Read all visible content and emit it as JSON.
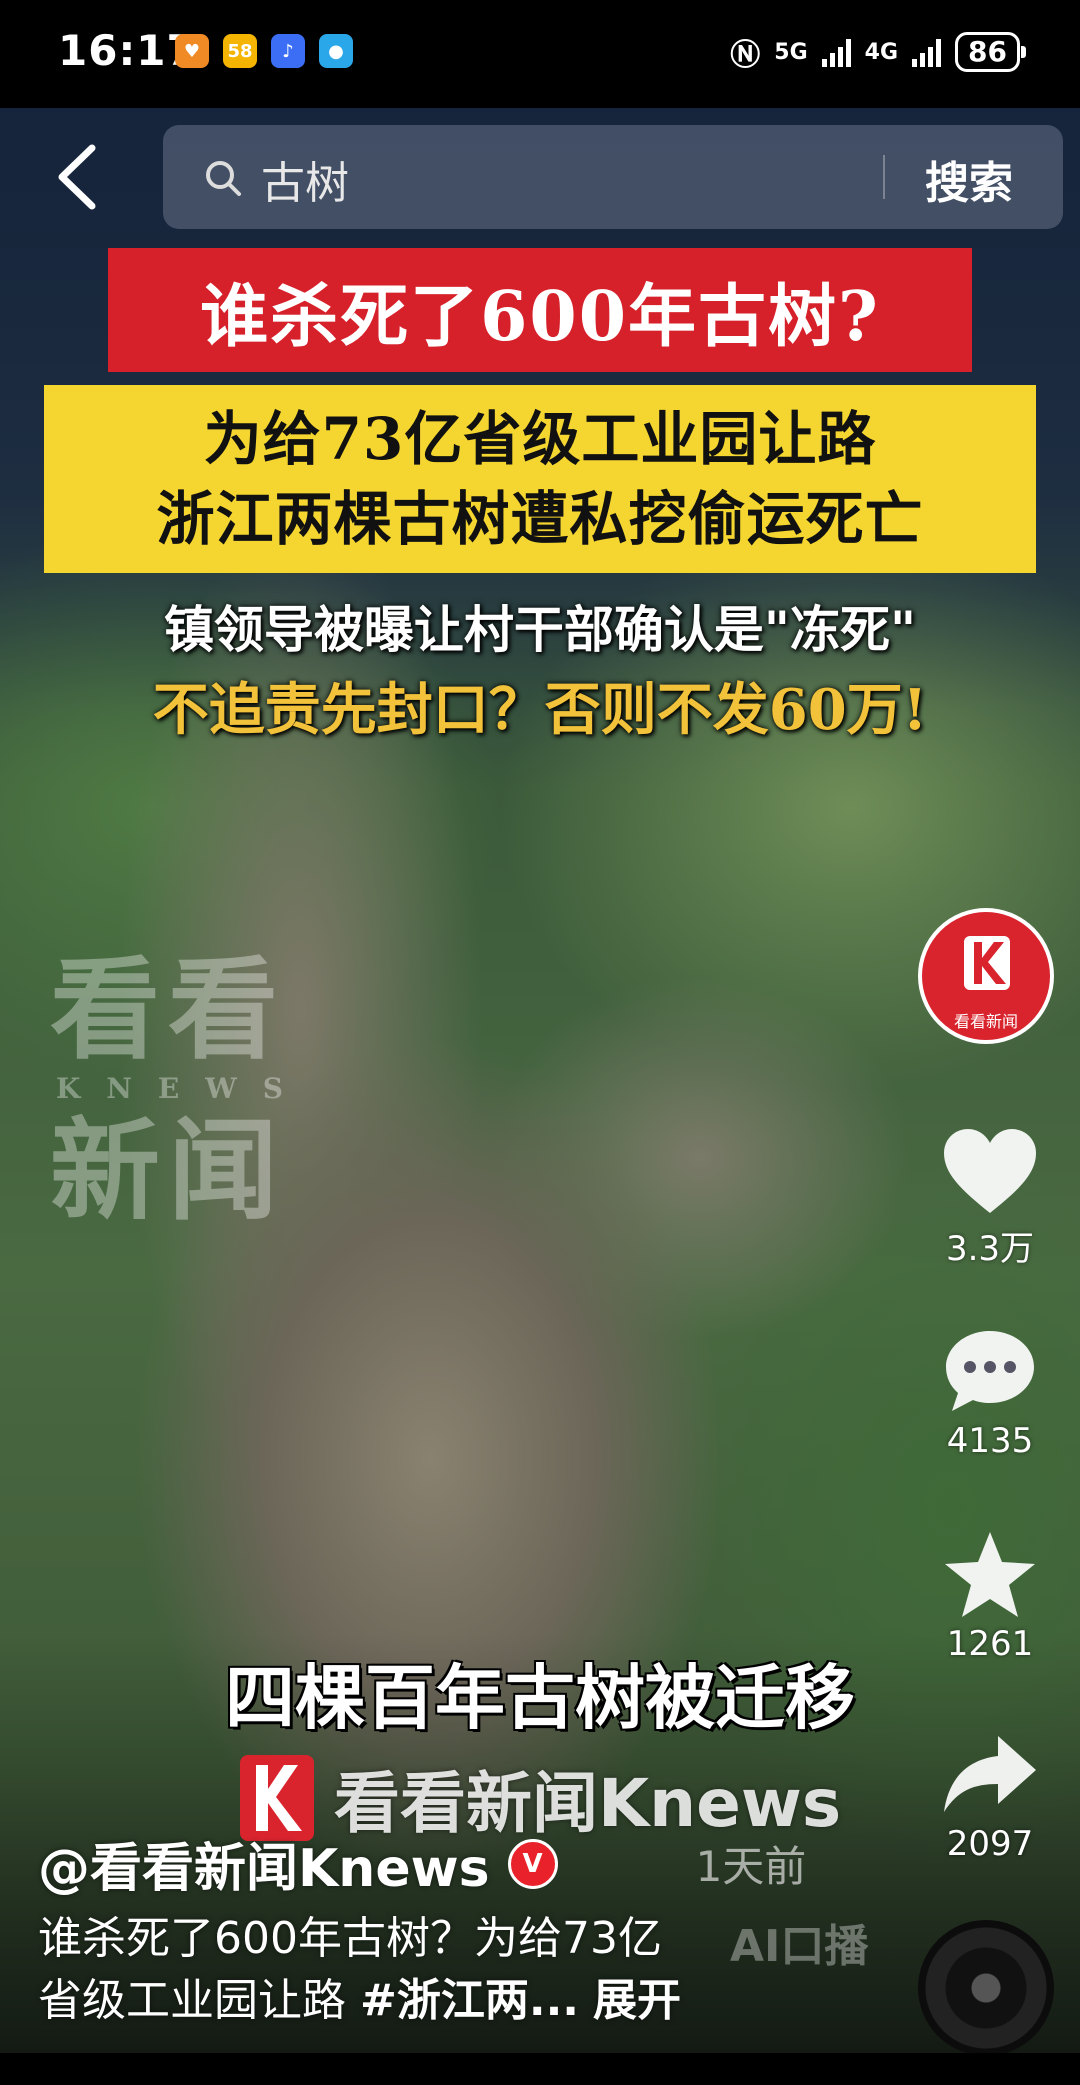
{
  "status_bar": {
    "time": "16:17",
    "apps": [
      {
        "icon": "app-orange-icon",
        "label": "",
        "color": "#f08a24"
      },
      {
        "icon": "app-58-icon",
        "label": "58",
        "color": "#f4b400"
      },
      {
        "icon": "music-icon",
        "label": "♪",
        "color": "#3b6ef5"
      },
      {
        "icon": "app-blue-icon",
        "label": "",
        "color": "#2aa7e8"
      }
    ],
    "network_1": "5G",
    "network_2": "4G",
    "battery": "86"
  },
  "search": {
    "query": "古树",
    "button_label": "搜索"
  },
  "video": {
    "headline": "谁杀死了600年古树?",
    "subhead_line1": "为给73亿省级工业园让路",
    "subhead_line2": "浙江两棵古树遭私挖偷运死亡",
    "line3": "镇领导被曝让村干部确认是\"冻死\"",
    "line4": "不追责先封口？否则不发60万!",
    "watermark_line1": "看看",
    "watermark_sub": "KNEWS",
    "watermark_line2": "新闻",
    "caption": "四棵百年古树被迁移",
    "brand_text": "看看新闻Knews",
    "ai_label": "AI口播"
  },
  "rail": {
    "avatar_text": "看看新闻",
    "likes": "3.3万",
    "comments": "4135",
    "favorites": "1261",
    "shares": "2097"
  },
  "post": {
    "author": "@看看新闻Knews",
    "verified_mark": "V",
    "time_ago": "1天前",
    "description_line1": "谁杀死了600年古树？为给73亿",
    "description_line2": "省级工业园让路",
    "hashtag": "#浙江两...",
    "more_label": "展开"
  },
  "colors": {
    "headline_bg": "#d6202a",
    "subhead_bg": "#f5d630",
    "highlight_text": "#f2c23a",
    "brand_red": "#e8212a"
  }
}
